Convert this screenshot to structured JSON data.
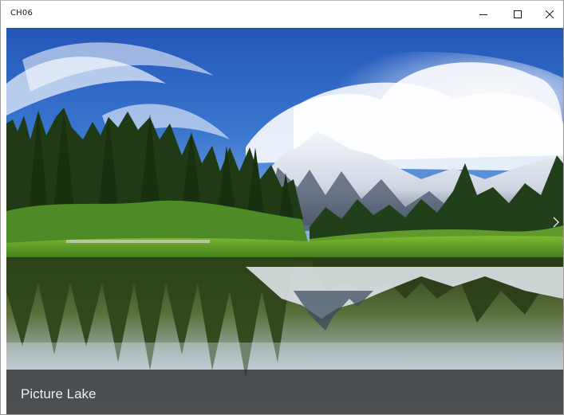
{
  "window": {
    "title": "CH06",
    "minimize_icon": "minimize-icon",
    "maximize_icon": "maximize-icon",
    "close_icon": "close-icon"
  },
  "viewer": {
    "next_icon": "chevron-right-icon",
    "caption": "Picture Lake"
  },
  "colors": {
    "caption_background": "#282828",
    "sky": "#2f68c4",
    "snow": "#f2f4f8",
    "forest": "#1f3a14",
    "grass": "#6fae2c"
  }
}
